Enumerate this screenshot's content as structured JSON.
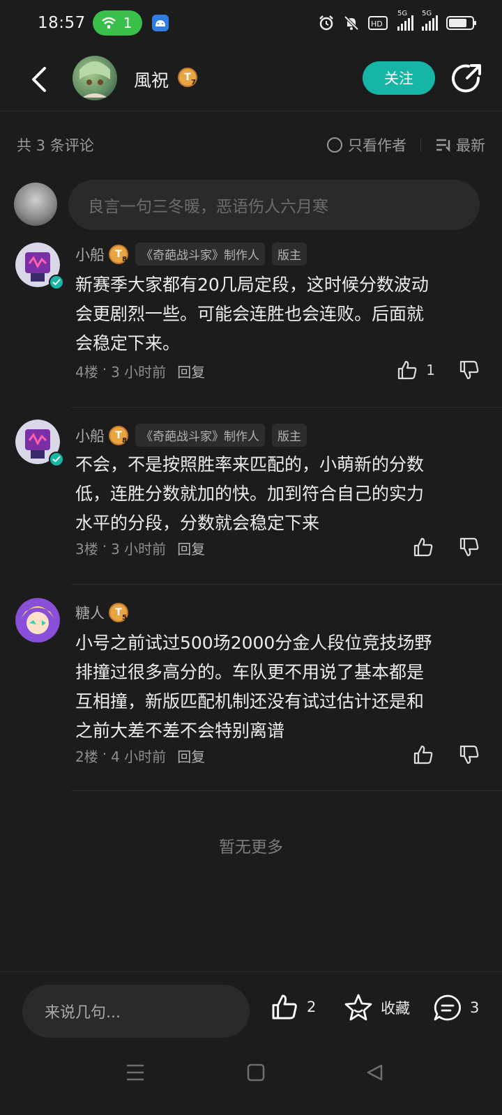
{
  "status_bar": {
    "time": "18:57",
    "hotspot_count": "1"
  },
  "header": {
    "title": "風祝",
    "level": "7",
    "follow_label": "关注"
  },
  "toolbar": {
    "count": "共 3 条评论",
    "author_only": "只看作者",
    "sort": "最新"
  },
  "composer": {
    "placeholder": "良言一句三冬暖，恶语伤人六月寒"
  },
  "comments": [
    {
      "name": "小船",
      "level": "8",
      "tag1": "《奇葩战斗家》制作人",
      "tag2": "版主",
      "lines": [
        "新赛季大家都有20几局定段，这时候分数波动",
        "会更剧烈一些。可能会连胜也会连败。后面就",
        "会稳定下来。"
      ],
      "floor": "4楼",
      "time": "3 小时前",
      "reply": "回复",
      "likes": "1"
    },
    {
      "name": "小船",
      "level": "8",
      "tag1": "《奇葩战斗家》制作人",
      "tag2": "版主",
      "lines": [
        "不会，不是按照胜率来匹配的，小萌新的分数",
        "低，连胜分数就加的快。加到符合自己的实力",
        "水平的分段，分数就会稳定下来"
      ],
      "floor": "3楼",
      "time": "3 小时前",
      "reply": "回复",
      "likes": ""
    },
    {
      "name": "糖人",
      "level": "5",
      "lines": [
        "小号之前试过500场2000分金人段位竞技场野",
        "排撞过很多高分的。车队更不用说了基本都是",
        "互相撞，新版匹配机制还没有试过估计还是和",
        "之前大差不差不会特别离谱"
      ],
      "floor": "2楼",
      "time": "4 小时前",
      "reply": "回复",
      "likes": ""
    }
  ],
  "no_more": "暂无更多",
  "bottom_bar": {
    "placeholder": "来说几句...",
    "likes": "2",
    "favorite": "收藏",
    "comments": "3"
  },
  "colors": {
    "accent": "#17b5a6",
    "background": "#1c1c1d",
    "badge": "#e9a541"
  }
}
